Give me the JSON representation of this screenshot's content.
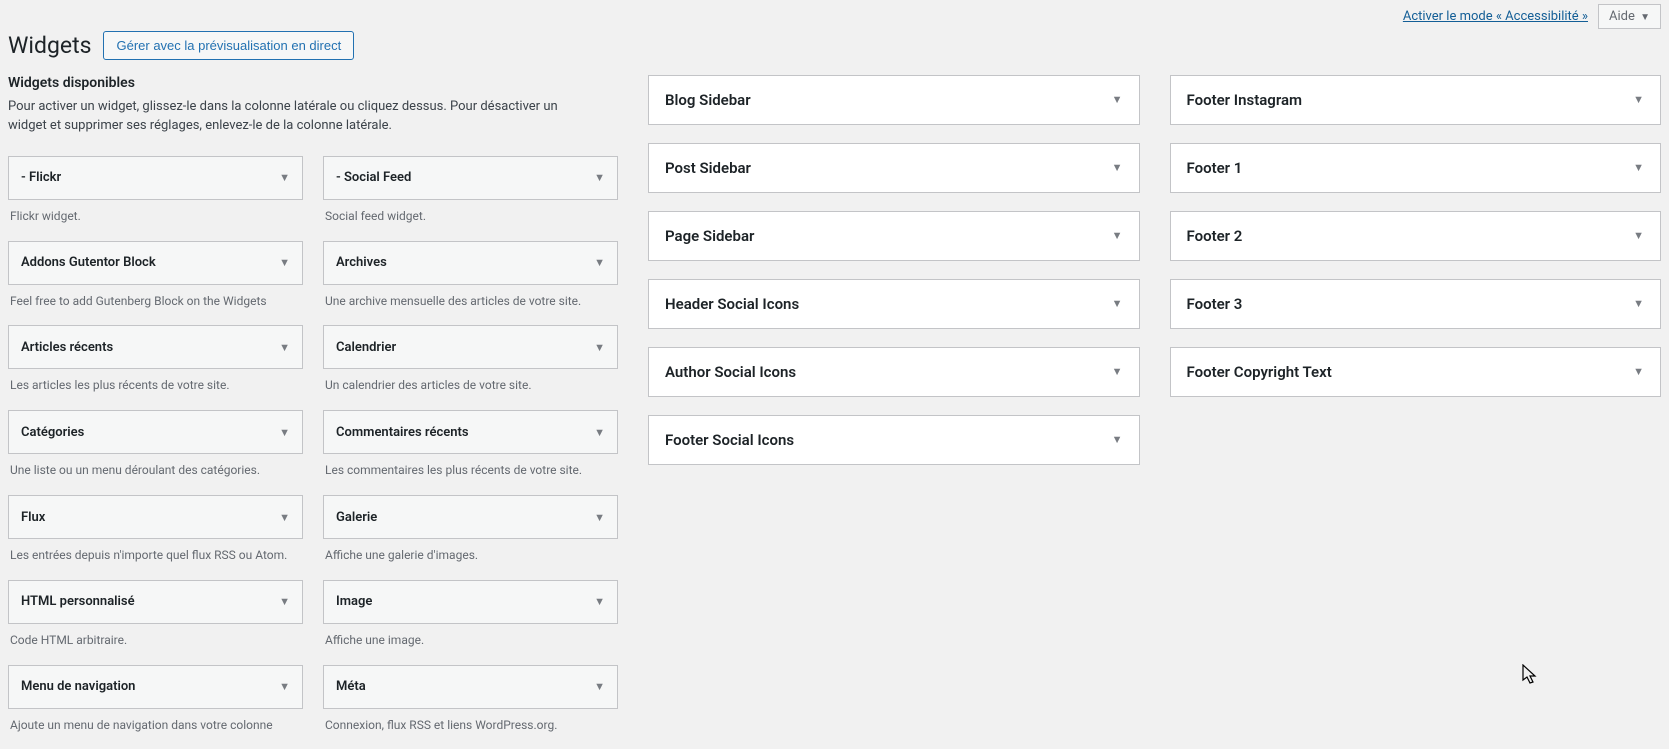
{
  "topbar": {
    "accessibility_link": "Activer le mode « Accessibilité »",
    "help_label": "Aide"
  },
  "header": {
    "title": "Widgets",
    "live_preview_button": "Gérer avec la prévisualisation en direct"
  },
  "available": {
    "heading": "Widgets disponibles",
    "description": "Pour activer un widget, glissez-le dans la colonne latérale ou cliquez dessus. Pour désactiver un widget et supprimer ses réglages, enlevez-le de la colonne latérale.",
    "widgets": [
      {
        "title": "- Flickr",
        "desc": "Flickr widget."
      },
      {
        "title": "- Social Feed",
        "desc": "Social feed widget."
      },
      {
        "title": "Addons Gutentor Block",
        "desc": "Feel free to add Gutenberg Block on the Widgets"
      },
      {
        "title": "Archives",
        "desc": "Une archive mensuelle des articles de votre site."
      },
      {
        "title": "Articles récents",
        "desc": "Les articles les plus récents de votre site."
      },
      {
        "title": "Calendrier",
        "desc": "Un calendrier des articles de votre site."
      },
      {
        "title": "Catégories",
        "desc": "Une liste ou un menu déroulant des catégories."
      },
      {
        "title": "Commentaires récents",
        "desc": "Les commentaires les plus récents de votre site."
      },
      {
        "title": "Flux",
        "desc": "Les entrées depuis n'importe quel flux RSS ou Atom."
      },
      {
        "title": "Galerie",
        "desc": "Affiche une galerie d'images."
      },
      {
        "title": "HTML personnalisé",
        "desc": "Code HTML arbitraire."
      },
      {
        "title": "Image",
        "desc": "Affiche une image."
      },
      {
        "title": "Menu de navigation",
        "desc": "Ajoute un menu de navigation dans votre colonne"
      },
      {
        "title": "Méta",
        "desc": "Connexion, flux RSS et liens WordPress.org."
      }
    ]
  },
  "areas": {
    "left": [
      "Blog Sidebar",
      "Post Sidebar",
      "Page Sidebar",
      "Header Social Icons",
      "Author Social Icons",
      "Footer Social Icons"
    ],
    "right": [
      "Footer Instagram",
      "Footer 1",
      "Footer 2",
      "Footer 3",
      "Footer Copyright Text"
    ]
  }
}
